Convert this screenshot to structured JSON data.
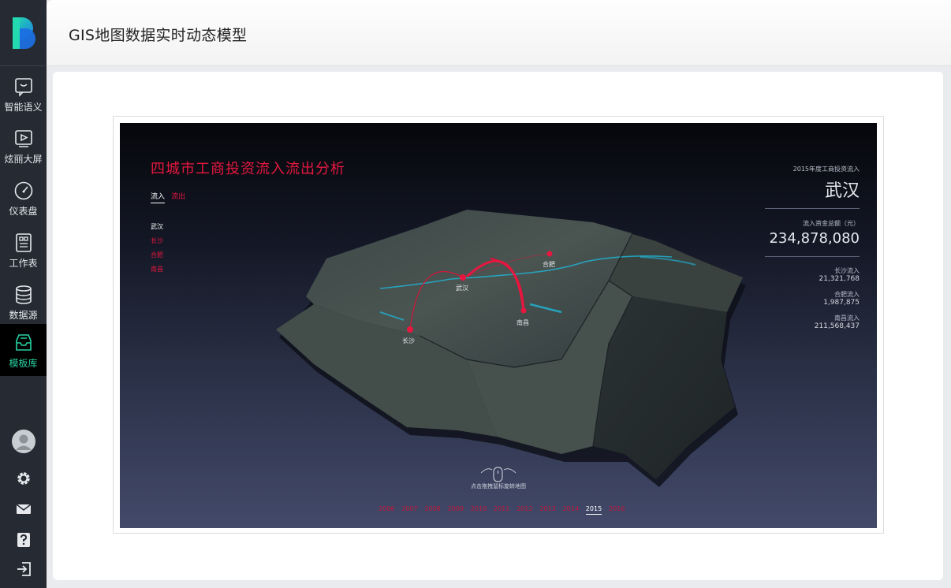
{
  "header": {
    "title": "GIS地图数据实时动态模型"
  },
  "sidebar": {
    "items": [
      {
        "label": "智能语义",
        "icon": "chat-bubble-icon",
        "active": false
      },
      {
        "label": "炫丽大屏",
        "icon": "play-screen-icon",
        "active": false
      },
      {
        "label": "仪表盘",
        "icon": "gauge-icon",
        "active": false
      },
      {
        "label": "工作表",
        "icon": "worksheet-icon",
        "active": false
      },
      {
        "label": "数据源",
        "icon": "database-icon",
        "active": false
      },
      {
        "label": "模板库",
        "icon": "template-tray-icon",
        "active": true
      }
    ],
    "bottom_icons": [
      "avatar-icon",
      "gear-icon",
      "mail-icon",
      "help-icon",
      "logout-icon"
    ],
    "active_color": "#27d3a3"
  },
  "dashboard": {
    "title": "四城市工商投资流入流出分析",
    "tabs": {
      "inflow": "流入",
      "outflow": "流出"
    },
    "cities": [
      "武汉",
      "长沙",
      "合肥",
      "南昌"
    ],
    "map_labels": {
      "wuhan": "武汉",
      "changsha": "长沙",
      "hefei": "合肥",
      "nanchang": "南昌"
    },
    "right_panel": {
      "year_caption": "2015年度工商投资流入",
      "city": "武汉",
      "total_caption": "流入资金总额（元）",
      "total_value": "234,878,080",
      "breakdown": [
        {
          "label": "长沙流入",
          "value": "21,321,768"
        },
        {
          "label": "合肥流入",
          "value": "1,987,875"
        },
        {
          "label": "南昌流入",
          "value": "211,568,437"
        }
      ]
    },
    "hint": "点击拖拽鼠标旋转地图",
    "years": [
      "2006",
      "2007",
      "2008",
      "2009",
      "2010",
      "2011",
      "2012",
      "2013",
      "2014",
      "2015",
      "2016"
    ],
    "selected_year": "2015",
    "accent_color": "#e8173f"
  }
}
